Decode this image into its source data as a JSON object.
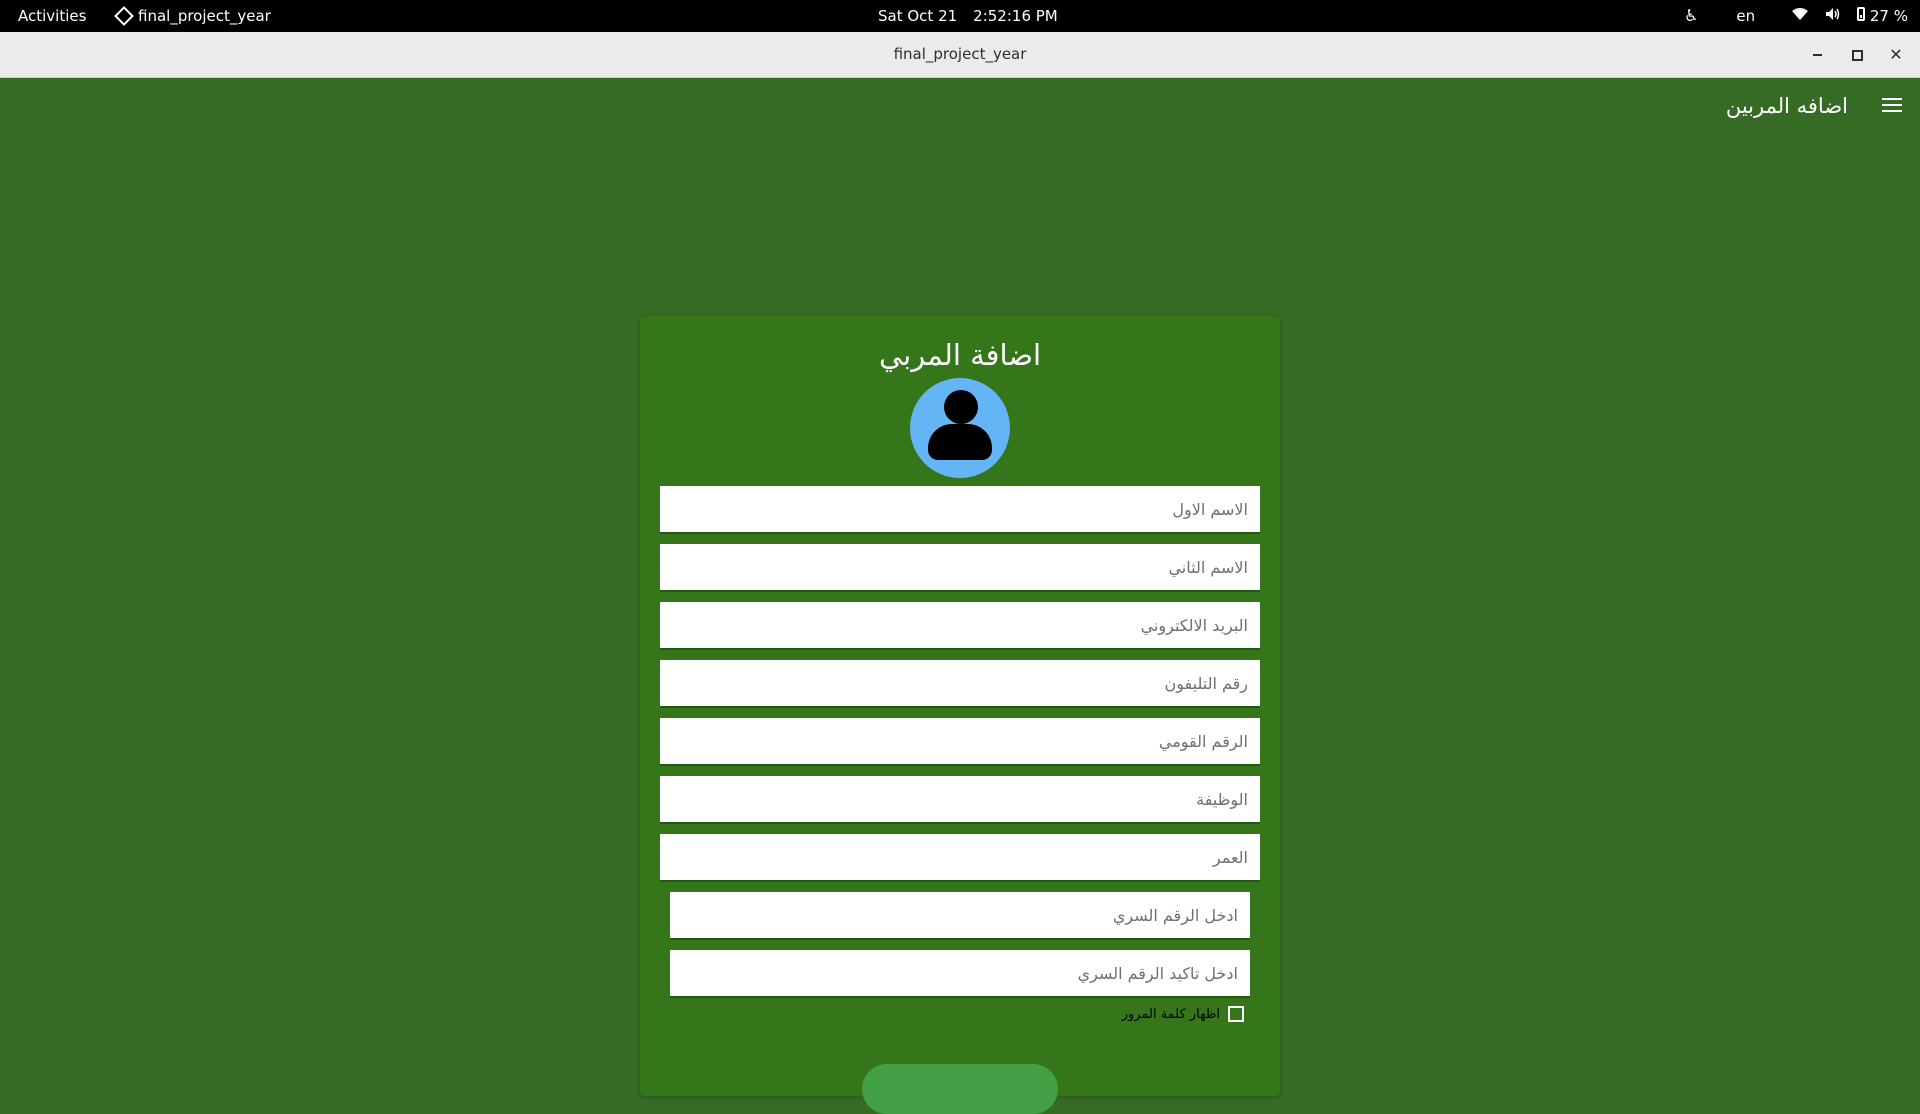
{
  "topbar": {
    "activities": "Activities",
    "app_name": "final_project_year",
    "date": "Sat Oct 21",
    "time": "2:52:16 PM",
    "language": "en",
    "battery": "27 %",
    "icons": [
      "accessibility-icon",
      "wifi-icon",
      "volume-icon",
      "battery-icon"
    ]
  },
  "window": {
    "title": "final_project_year",
    "controls": [
      "minimize",
      "maximize",
      "close"
    ]
  },
  "appbar": {
    "title": "اضافه المربين",
    "menu_icon": "hamburger-menu-icon"
  },
  "form": {
    "title": "اضافة المربي",
    "avatar_icon": "person-icon",
    "fields": [
      {
        "placeholder": "الاسم الاول",
        "value": ""
      },
      {
        "placeholder": "الاسم الثاني",
        "value": ""
      },
      {
        "placeholder": "البريد الالكتروني",
        "value": ""
      },
      {
        "placeholder": "رقم التليفون",
        "value": ""
      },
      {
        "placeholder": "الرقم القومي",
        "value": ""
      },
      {
        "placeholder": "الوظيفة",
        "value": ""
      },
      {
        "placeholder": "العمر",
        "value": ""
      },
      {
        "placeholder": "ادخل الرقم السري",
        "value": ""
      },
      {
        "placeholder": "ادخل تاكيد الرقم السري",
        "value": ""
      }
    ],
    "show_password_label": "اظهار كلمة المرور",
    "show_password_checked": false
  },
  "colors": {
    "background": "#356b25",
    "card": "#347619",
    "avatar": "#64b5f6",
    "submit_button": "#43a047"
  }
}
